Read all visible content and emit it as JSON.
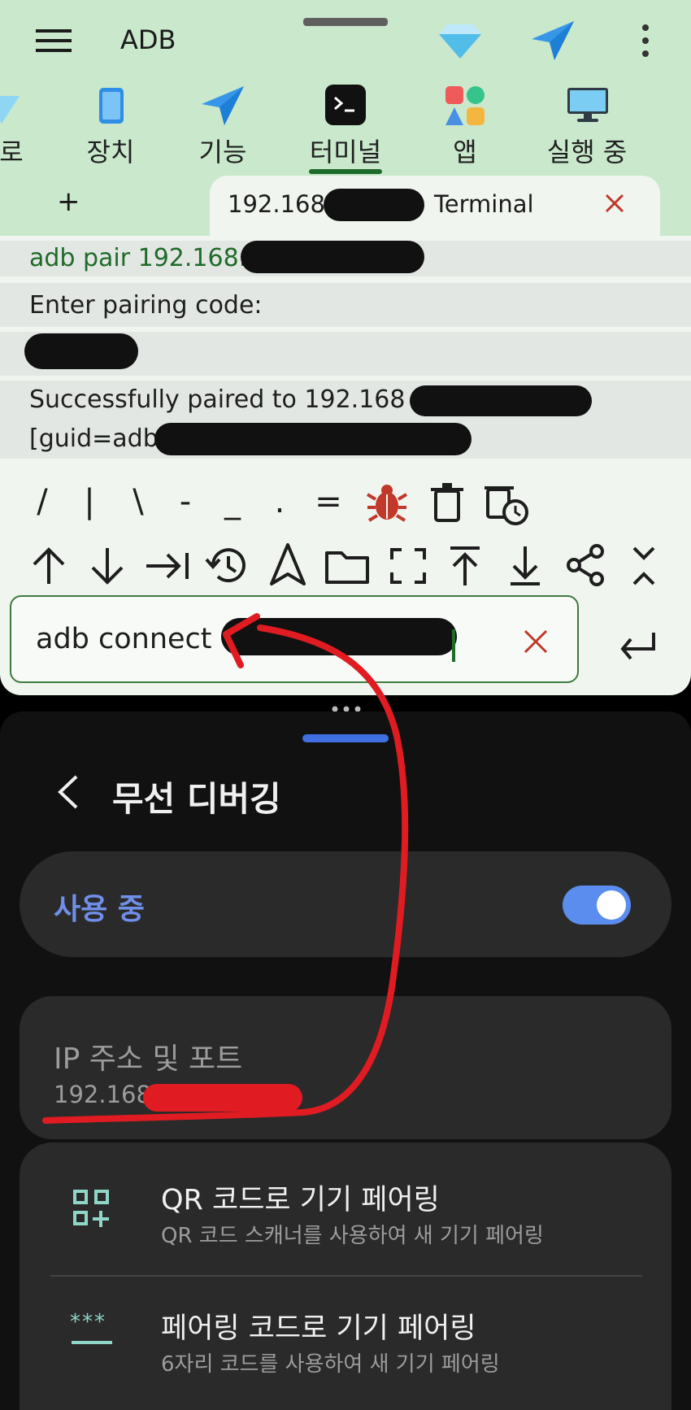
{
  "app": {
    "title": "ADB"
  },
  "tabs": [
    {
      "label": "로"
    },
    {
      "label": "장치"
    },
    {
      "label": "기능"
    },
    {
      "label": "터미널"
    },
    {
      "label": "앱"
    },
    {
      "label": "실행 중"
    }
  ],
  "session": {
    "tab_title_prefix": "192.168",
    "tab_title_suffix": "Terminal",
    "add_label": "+"
  },
  "terminal": {
    "lines": [
      "adb pair 192.168.",
      "Enter pairing code:",
      "",
      "Successfully paired to 192.168",
      "[guid=adb-"
    ]
  },
  "keys": {
    "row1": [
      "/",
      "|",
      "\\",
      "-",
      "_",
      ".",
      "="
    ]
  },
  "command": {
    "value": "adb connect "
  },
  "settings": {
    "page_title": "무선 디버깅",
    "toggle_label": "사용 중",
    "toggle_on": true,
    "ip_title": "IP 주소 및 포트",
    "ip_value": "192.168.",
    "qr_title": "QR 코드로 기기 페어링",
    "qr_sub": "QR 코드 스캐너를 사용하여 새 기기 페어링",
    "code_title": "페어링 코드로 기기 페어링",
    "code_sub": "6자리 코드를 사용하여 새 기기 페어링",
    "code_icon_glyph": "***"
  },
  "colors": {
    "accent_green": "#1f6b2a",
    "danger": "#c0392b",
    "toggle_blue": "#5b8def",
    "annotation_red": "#e11b22"
  }
}
